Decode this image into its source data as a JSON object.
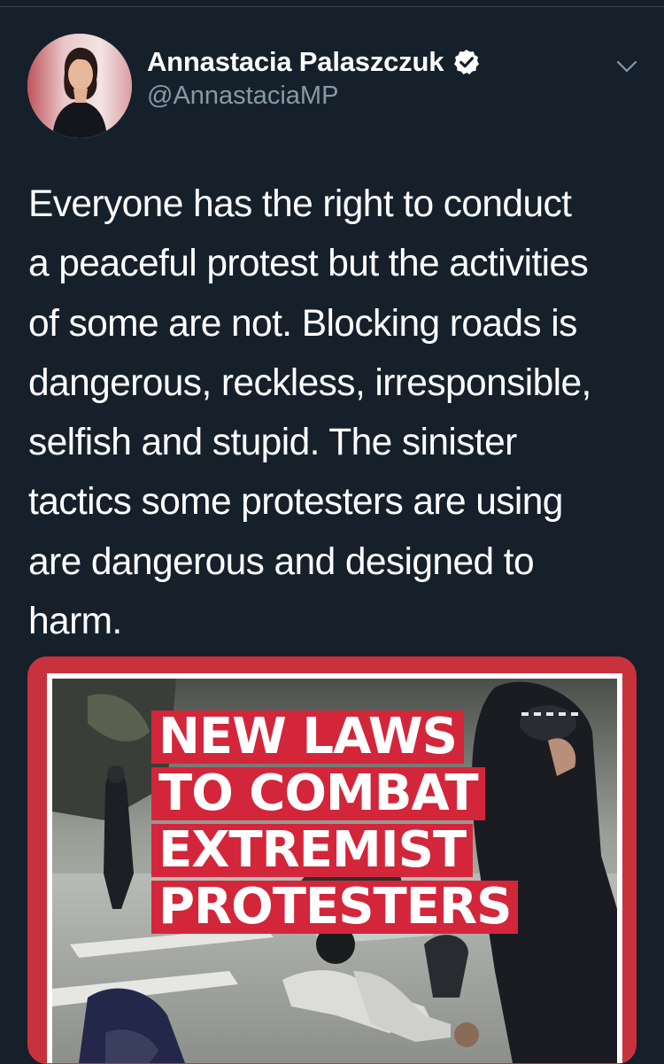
{
  "tweet": {
    "author": {
      "display_name": "Annastacia Palaszczuk",
      "handle": "@AnnastaciaMP",
      "verified": true
    },
    "text": "Everyone has the right to conduct\na peaceful protest but the activities\nof some are not. Blocking roads is\ndangerous, reckless, irresponsible,\nselfish and stupid. The sinister\ntactics some protesters are using\nare dangerous and designed to\nharm.",
    "media": {
      "headline_lines": [
        "NEW LAWS",
        "TO COMBAT",
        "EXTREMIST",
        "PROTESTERS"
      ]
    }
  },
  "icons": {
    "verified": "verified-badge-icon",
    "more": "chevron-down-icon"
  },
  "colors": {
    "background": "#15202b",
    "text": "#ffffff",
    "secondary_text": "#8899a6",
    "headline_red": "#d3263a",
    "frame_red": "#c8323c"
  }
}
